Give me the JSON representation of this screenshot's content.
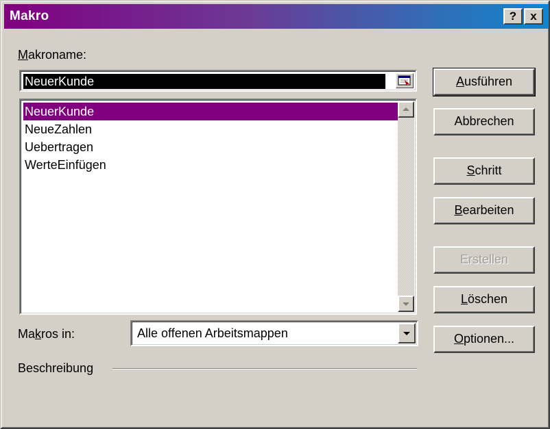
{
  "window": {
    "title": "Makro"
  },
  "titlebar": {
    "help": "?",
    "close": "x"
  },
  "makroname": {
    "label_mnemonic": "M",
    "label_rest": "akroname:",
    "value": "NeuerKunde"
  },
  "list": {
    "items": [
      "NeuerKunde",
      "NeueZahlen",
      "Uebertragen",
      "WerteEinfügen"
    ],
    "selected_index": 0
  },
  "makros_in": {
    "label_pre": "Ma",
    "label_mnemonic": "k",
    "label_post": "ros in:",
    "value": "Alle offenen Arbeitsmappen"
  },
  "beschreibung": {
    "label": "Beschreibung"
  },
  "buttons": {
    "ausfuehren": {
      "mn": "A",
      "rest": "usführen"
    },
    "abbrechen": {
      "label": "Abbrechen"
    },
    "schritt": {
      "mn": "S",
      "rest": "chritt"
    },
    "bearbeiten": {
      "mn": "B",
      "rest": "earbeiten"
    },
    "erstellen": {
      "label": "Erstellen"
    },
    "loeschen": {
      "mn": "L",
      "rest": "öschen"
    },
    "optionen": {
      "mn": "O",
      "rest": "ptionen..."
    }
  },
  "colors": {
    "title_start": "#800080",
    "title_end": "#1084d0",
    "selection": "#800080",
    "face": "#d4d0c8"
  }
}
